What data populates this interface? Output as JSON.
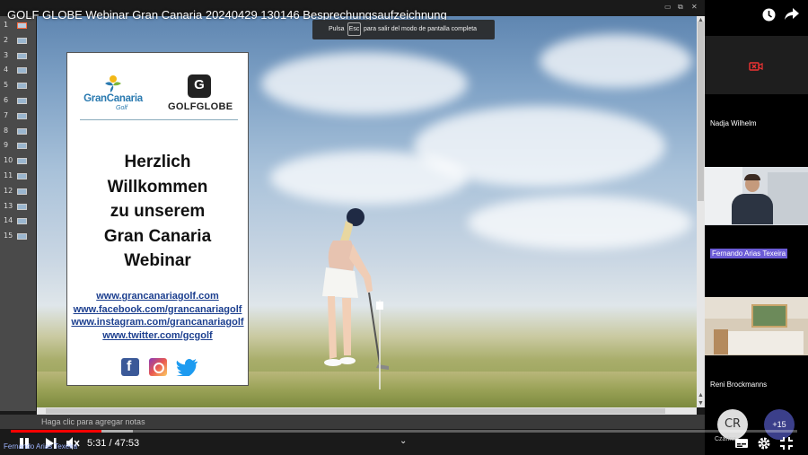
{
  "window": {
    "title": "GOLF GLOBE Webinar Gran Canaria 20240429 130146 Besprechungsaufzeichnung",
    "fullscreen_notice": {
      "prefix": "Pulsa",
      "key": "Esc",
      "suffix": "para salir del modo de pantalla completa"
    }
  },
  "slide_rail": {
    "active_index": 1,
    "numbers": [
      "1",
      "2",
      "3",
      "4",
      "5",
      "6",
      "7",
      "8",
      "9",
      "10",
      "11",
      "12",
      "13",
      "14",
      "15"
    ]
  },
  "slide": {
    "logos": {
      "gran_canaria": "GranCanaria",
      "gran_canaria_sub": "Golf",
      "golf_globe": "GOLFGLOBE",
      "golf_globe_badge": "G"
    },
    "welcome_lines": [
      "Herzlich",
      "Willkommen",
      "zu unserem",
      "Gran Canaria",
      "Webinar"
    ],
    "links": [
      "www.grancanariagolf.com",
      "www.facebook.com/grancanariagolf",
      "www.instagram.com/grancanariagolf",
      "www.twitter.com/gcgolf"
    ],
    "social_icons": [
      "facebook-icon",
      "instagram-icon",
      "twitter-icon"
    ]
  },
  "notes": {
    "placeholder": "Haga clic para agregar notas"
  },
  "player": {
    "current_time": "5:31",
    "separator": "/",
    "duration": "47:53",
    "progress_fraction": 0.115,
    "buffered_fraction": 0.155,
    "caption_overlay": "Fernando Arias Texeira",
    "accent_color": "#ff0000"
  },
  "participants": {
    "tiles": [
      {
        "name": "Nadja Wilhelm",
        "camera": "off"
      },
      {
        "name": "Fernando Arias Texeira",
        "camera": "on",
        "highlighted": true
      },
      {
        "name": "Reni Brockmanns",
        "camera": "on"
      }
    ],
    "avatar": {
      "initials": "CR",
      "name": "Czarina"
    },
    "more_count": "+15"
  }
}
